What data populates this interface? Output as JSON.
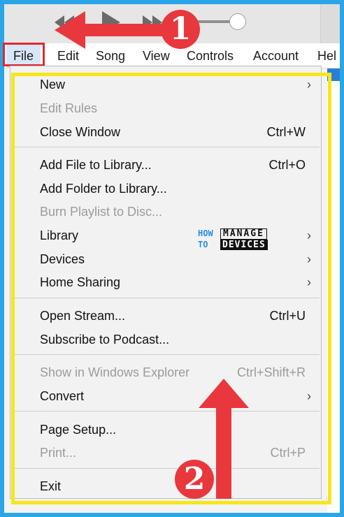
{
  "menubar": {
    "items": [
      {
        "label": "File"
      },
      {
        "label": "Edit"
      },
      {
        "label": "Song"
      },
      {
        "label": "View"
      },
      {
        "label": "Controls"
      },
      {
        "label": "Account"
      },
      {
        "label": "Hel"
      }
    ]
  },
  "file_menu": {
    "items": [
      {
        "label": "New",
        "shortcut": "",
        "submenu": true,
        "enabled": true
      },
      {
        "label": "Edit Rules",
        "shortcut": "",
        "submenu": false,
        "enabled": false
      },
      {
        "label": "Close Window",
        "shortcut": "Ctrl+W",
        "submenu": false,
        "enabled": true
      },
      {
        "label": "Add File to Library...",
        "shortcut": "Ctrl+O",
        "submenu": false,
        "enabled": true
      },
      {
        "label": "Add Folder to Library...",
        "shortcut": "",
        "submenu": false,
        "enabled": true
      },
      {
        "label": "Burn Playlist to Disc...",
        "shortcut": "",
        "submenu": false,
        "enabled": false
      },
      {
        "label": "Library",
        "shortcut": "",
        "submenu": true,
        "enabled": true
      },
      {
        "label": "Devices",
        "shortcut": "",
        "submenu": true,
        "enabled": true
      },
      {
        "label": "Home Sharing",
        "shortcut": "",
        "submenu": true,
        "enabled": true
      },
      {
        "label": "Open Stream...",
        "shortcut": "Ctrl+U",
        "submenu": false,
        "enabled": true
      },
      {
        "label": "Subscribe to Podcast...",
        "shortcut": "",
        "submenu": false,
        "enabled": true
      },
      {
        "label": "Show in Windows Explorer",
        "shortcut": "Ctrl+Shift+R",
        "submenu": false,
        "enabled": false
      },
      {
        "label": "Convert",
        "shortcut": "",
        "submenu": true,
        "enabled": true
      },
      {
        "label": "Page Setup...",
        "shortcut": "",
        "submenu": false,
        "enabled": true
      },
      {
        "label": "Print...",
        "shortcut": "Ctrl+P",
        "submenu": false,
        "enabled": false
      },
      {
        "label": "Exit",
        "shortcut": "",
        "submenu": false,
        "enabled": true
      }
    ],
    "submenu_arrow": "›"
  },
  "watermark": {
    "how": "HOW",
    "to": "TO",
    "manage": "MANAGE",
    "devices": "DEVICES"
  },
  "annotations": {
    "step1": "1",
    "step2": "2",
    "arrow_color": "#e8383d",
    "highlight_color": "#f7e61b"
  },
  "colors": {
    "background": "#2aa6e8",
    "menu_bg": "#f2f2f2",
    "disabled_text": "#9b9b9b"
  }
}
